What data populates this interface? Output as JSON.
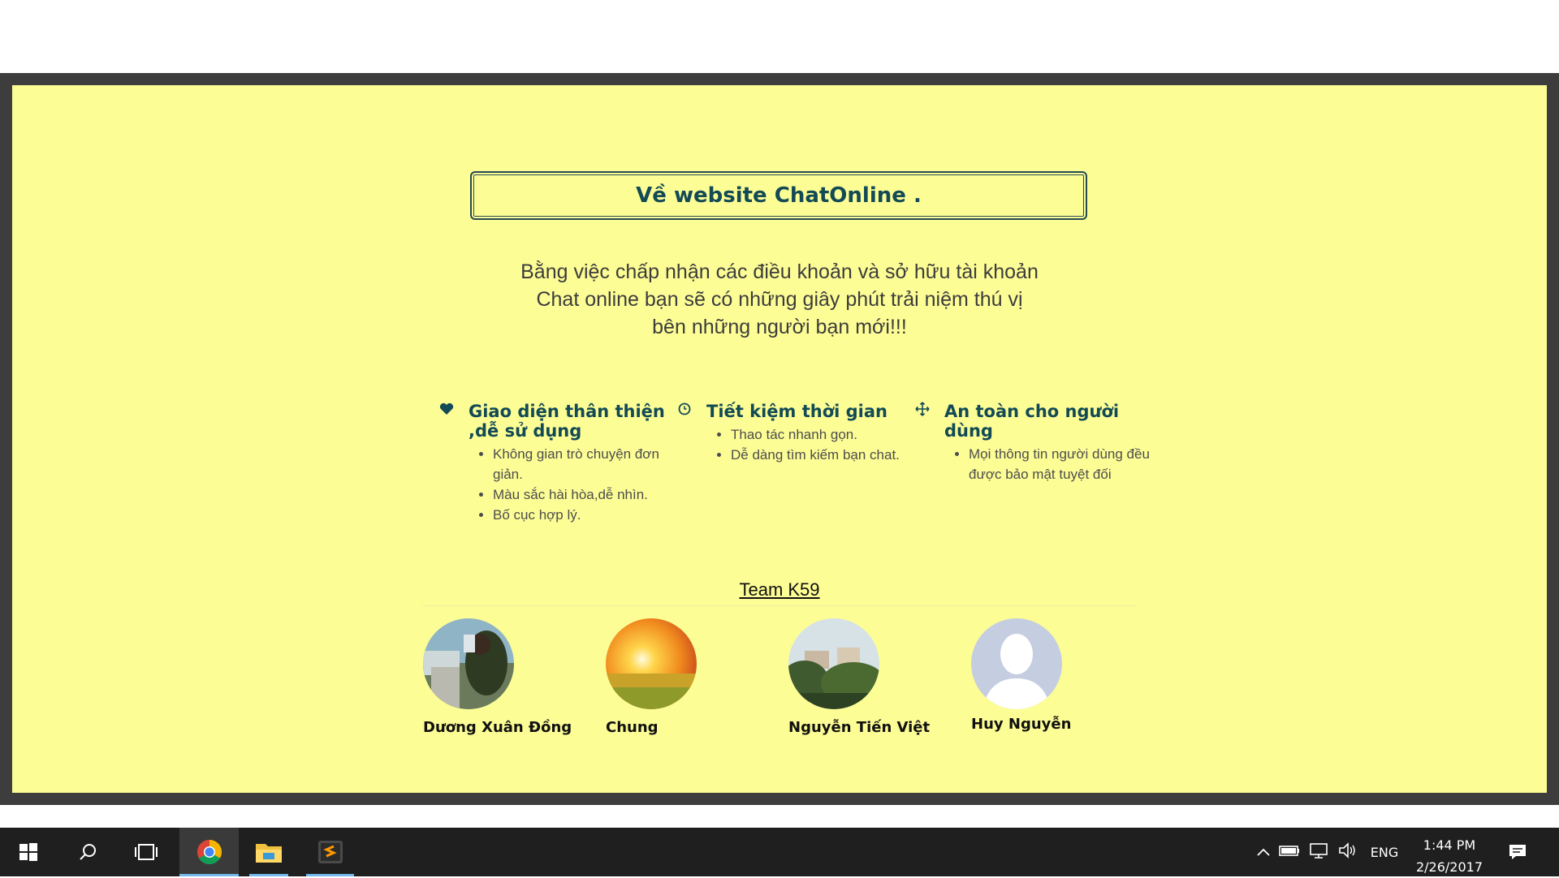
{
  "page": {
    "title": "Về website ChatOnline .",
    "intro_lines": [
      "Bằng việc chấp nhận các điều khoản và sở hữu tài khoản",
      "Chat online bạn sẽ có những giây phút trải niệm thú vị",
      "bên những người bạn mới!!!"
    ]
  },
  "features": [
    {
      "icon": "heart-icon",
      "title": "Giao diện thân thiện ,dễ sử dụng",
      "items": [
        "Không gian trò chuyện đơn giản.",
        "Màu sắc hài hòa,dễ nhìn.",
        "Bố cục hợp lý."
      ]
    },
    {
      "icon": "clock-icon",
      "title": "Tiết kiệm thời gian",
      "items": [
        "Thao tác nhanh gọn.",
        "Dễ dàng tìm kiếm bạn chat."
      ]
    },
    {
      "icon": "move-icon",
      "title": "An toàn cho người dùng",
      "items": [
        "Mọi thông tin người dùng đều được bảo mật tuyệt đối"
      ]
    }
  ],
  "team": {
    "title": "Team K59",
    "members": [
      {
        "name": "Dương Xuân Đồng",
        "avatar": "photo-avatar"
      },
      {
        "name": "Chung",
        "avatar": "sunset-avatar"
      },
      {
        "name": "Nguyễn Tiến Việt",
        "avatar": "village-avatar"
      },
      {
        "name": "Huy Nguyễn",
        "avatar": "default-avatar"
      }
    ]
  },
  "taskbar": {
    "apps": [
      "windows-start-icon",
      "search-icon",
      "task-view-icon",
      "chrome-icon",
      "file-explorer-icon",
      "sublime-text-icon"
    ],
    "language": "ENG",
    "time": "1:44 PM",
    "date": "2/26/2017"
  },
  "colors": {
    "panel_bg": "#fdfd96",
    "frame": "#3d3d3d",
    "heading": "#124a55",
    "taskbar": "#1f1f1f"
  }
}
